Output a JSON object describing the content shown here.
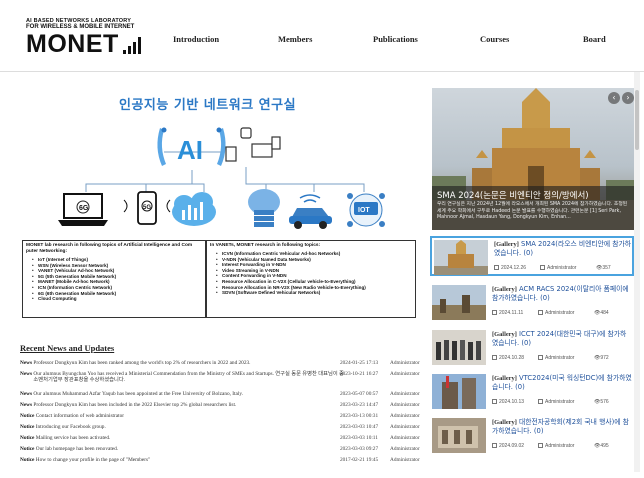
{
  "header": {
    "logo_line1": "AI BASED NETWORKS LABORATORY",
    "logo_line2": "FOR WIRELESS & MOBILE INTERNET",
    "logo_main": "MONET",
    "nav": [
      {
        "label": "Introduction"
      },
      {
        "label": "Members"
      },
      {
        "label": "Publications"
      },
      {
        "label": "Courses"
      },
      {
        "label": "Board"
      }
    ]
  },
  "infographic": {
    "title": "인공지능 기반 네트워크 연구실",
    "ai_label": "AI",
    "iot_label": "IOT",
    "g6_label": "6G",
    "g5_label": "5G",
    "box_left": {
      "heading": "MONET lab research in following topics of Artificial Intelligence and Com puter Networking:",
      "items": [
        "IoT (Internet of Things)",
        "WSN (Wireless Sensor Network)",
        "VANET (Vehicular Ad-hoc Network)",
        "5G (5th Generation Mobile Network)",
        "MANET (Mobile Ad-hoc Network)",
        "ICN (Information Centric Network)",
        "6G (6th Generation Mobile Network)",
        "Cloud Computing"
      ]
    },
    "box_right": {
      "heading": "In VANETs, MONET research in following topics:",
      "items": [
        "ICVN  (Information Centric Vehicular Ad-hoc Networks)",
        "V-NDN  (Vehicular Named Data Networks)",
        "Interest Forwarding in V-NDN",
        "Video Streaming in V-NDN",
        "Content Forwarding in V-NDN",
        "Resource Allocation in C-V2X  (Cellular vehicle-to-Everything)",
        "Resource Allocation in NR-V2X  (New Radio Vehicle-to-Everything)",
        "SDVN  (Software Defined Vehicular Networks)"
      ]
    }
  },
  "news": {
    "title": "Recent News and Updates",
    "rows": [
      {
        "cat": "News",
        "text": "Professor Dongkyun Kim has been ranked among the world's top 2% of researchers in 2022 and 2023.",
        "date": "2024-01-25 17:13",
        "author": "Administrator"
      },
      {
        "cat": "News",
        "text": "Our alumnus Byungchan Yoo has received a Ministerial Commendation from the Ministry of SMEs and Startups. 연구실 동문 유병찬 대표님이 중소벤처기업부 장관표창을 수상하셨습니다.",
        "date": "2023-10-21 16:27",
        "author": "Administrator"
      },
      {
        "cat": "News",
        "text": "Our alumnus Muhammad Azfar Yaqub has been appointed at the Free University of Bolzano, Italy.",
        "date": "2023-05-07 00:57",
        "author": "Administrator"
      },
      {
        "cat": "News",
        "text": "Professor Dongkyun Kim has been included in the 2022 Elsevier top 2% global researchers list.",
        "date": "2023-03-23 14:47",
        "author": "Administrator"
      },
      {
        "cat": "Notice",
        "text": "Contact information of web administrator",
        "date": "2023-03-13 00:31",
        "author": "Administrator"
      },
      {
        "cat": "Notice",
        "text": "Introducing our Facebook group.",
        "date": "2023-03-03 10:47",
        "author": "Administrator"
      },
      {
        "cat": "Notice",
        "text": "Mailing service has been activated.",
        "date": "2023-03-03 10:11",
        "author": "Administrator"
      },
      {
        "cat": "Notice",
        "text": "Our lab homepage has been renovated.",
        "date": "2023-03-03 09:27",
        "author": "Administrator"
      },
      {
        "cat": "Notice",
        "text": "How to change your profile in the page of \"Members\"",
        "date": "2017-02-21 19:45",
        "author": "Administrator"
      }
    ]
  },
  "slider": {
    "title": "SMA 2024(논문은 비엔티안 정의/방에서)",
    "text": "우리 연구실은 지난 2024년 12월에 라오스에서 개최된 SMA 2024에 참가하였습니다. 초청된 세계 주요 학회에서 구두로 Hadeed 논문 발표를 수행하였습니다. 관련논문 [1] Seri Park, Mahnoor Ajmal, Hasdaun Yang, Dongkyun Kim, Enhan...",
    "prev": "‹",
    "next": "›",
    "colors": {
      "caption_bg": "#1e1e1e",
      "sky": "#c6cfd6",
      "stone": "#b8843e"
    }
  },
  "gallery": [
    {
      "tag": "[Gallery]",
      "title": "SMA 2024(라오스 비엔티안에 참가하였습니다.",
      "count": "(0)",
      "date": "2024.12.26",
      "author": "Administrator",
      "views": "357"
    },
    {
      "tag": "[Gallery]",
      "title": "ACM RACS 2024(이탈리아 폼페이에 참가하였습니다.",
      "count": "(0)",
      "date": "2024.11.11",
      "author": "Administrator",
      "views": "484"
    },
    {
      "tag": "[Gallery]",
      "title": "ICCT 2024(대한민국 대구)에 참가하였습니다.",
      "count": "(0)",
      "date": "2024.10.28",
      "author": "Administrator",
      "views": "972"
    },
    {
      "tag": "[Gallery]",
      "title": "VTC2024(미국 워싱턴DC)에 참가하였습니다.",
      "count": "(0)",
      "date": "2024.10.13",
      "author": "Administrator",
      "views": "576"
    },
    {
      "tag": "[Gallery]",
      "title": "대한전자공학회(제2회 국내 행사)에 참가하였습니다.",
      "count": "(0)",
      "date": "2024.09.02",
      "author": "Administrator",
      "views": "495"
    }
  ]
}
